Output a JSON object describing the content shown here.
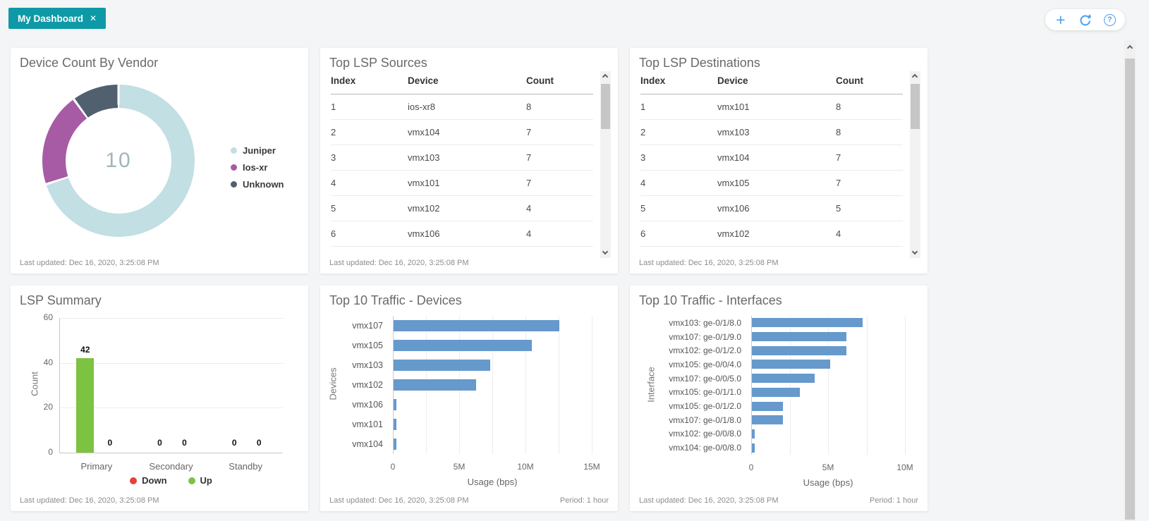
{
  "tab": {
    "label": "My Dashboard",
    "close_icon": "✕"
  },
  "toolbar": {
    "add_icon": "+",
    "help_icon": "?"
  },
  "colors": {
    "tab_teal": "#0e99a6",
    "toolbar_blue": "#49a0ef",
    "bar_blue": "#6699cc",
    "up_green": "#7cc342",
    "down_red": "#e8413c"
  },
  "panels": {
    "vendor": {
      "title": "Device Count By Vendor",
      "last_updated": "Last updated: Dec 16, 2020, 3:25:08 PM",
      "chart_data": {
        "type": "pie",
        "total_label": "10",
        "slices": [
          {
            "label": "Juniper",
            "value": 7,
            "color": "#c2dfe3"
          },
          {
            "label": "Ios-xr",
            "value": 2,
            "color": "#a75ba5"
          },
          {
            "label": "Unknown",
            "value": 1,
            "color": "#51606e"
          }
        ],
        "legend_position": "right"
      }
    },
    "lsp_sources": {
      "title": "Top LSP Sources",
      "columns": [
        "Index",
        "Device",
        "Count"
      ],
      "rows": [
        [
          "1",
          "ios-xr8",
          "8"
        ],
        [
          "2",
          "vmx104",
          "7"
        ],
        [
          "3",
          "vmx103",
          "7"
        ],
        [
          "4",
          "vmx101",
          "7"
        ],
        [
          "5",
          "vmx102",
          "4"
        ],
        [
          "6",
          "vmx106",
          "4"
        ]
      ],
      "last_updated": "Last updated: Dec 16, 2020, 3:25:08 PM"
    },
    "lsp_destinations": {
      "title": "Top LSP Destinations",
      "columns": [
        "Index",
        "Device",
        "Count"
      ],
      "rows": [
        [
          "1",
          "vmx101",
          "8"
        ],
        [
          "2",
          "vmx103",
          "8"
        ],
        [
          "3",
          "vmx104",
          "7"
        ],
        [
          "4",
          "vmx105",
          "7"
        ],
        [
          "5",
          "vmx106",
          "5"
        ],
        [
          "6",
          "vmx102",
          "4"
        ]
      ],
      "last_updated": "Last updated: Dec 16, 2020, 3:25:08 PM"
    },
    "lsp_summary": {
      "title": "LSP Summary",
      "last_updated": "Last updated: Dec 16, 2020, 3:25:08 PM",
      "chart_data": {
        "type": "bar",
        "categories": [
          "Primary",
          "Secondary",
          "Standby"
        ],
        "series": [
          {
            "name": "Down",
            "color": "#e8413c",
            "values": [
              0,
              0,
              0
            ]
          },
          {
            "name": "Up",
            "color": "#7cc342",
            "values": [
              42,
              0,
              0
            ]
          }
        ],
        "slot_order": [
          "Up",
          "Down"
        ],
        "legend": [
          "Down",
          "Up"
        ],
        "ylabel": "Count",
        "yticks": [
          0,
          20,
          40,
          60
        ],
        "ylim": [
          0,
          60
        ],
        "grid": true,
        "legend_position": "bottom"
      }
    },
    "traffic_devices": {
      "title": "Top 10 Traffic - Devices",
      "last_updated": "Last updated: Dec 16, 2020, 3:25:08 PM",
      "period": "Period: 1 hour",
      "chart_data": {
        "type": "bar-horizontal",
        "categories": [
          "vmx107",
          "vmx105",
          "vmx103",
          "vmx102",
          "vmx106",
          "vmx101",
          "vmx104"
        ],
        "values": [
          12500000,
          10400000,
          7300000,
          6200000,
          200000,
          200000,
          200000
        ],
        "bar_color": "#6699cc",
        "xticks": [
          {
            "label": "0",
            "value": 0
          },
          {
            "label": "5M",
            "value": 5000000
          },
          {
            "label": "10M",
            "value": 10000000
          },
          {
            "label": "15M",
            "value": 15000000
          }
        ],
        "xlim": [
          0,
          15000000
        ],
        "grid_step": 2500000,
        "xlabel": "Usage (bps)",
        "ylabel": "Devices"
      }
    },
    "traffic_interfaces": {
      "title": "Top 10 Traffic - Interfaces",
      "last_updated": "Last updated: Dec 16, 2020, 3:25:08 PM",
      "period": "Period: 1 hour",
      "chart_data": {
        "type": "bar-horizontal",
        "categories": [
          "vmx103: ge-0/1/8.0",
          "vmx107: ge-0/1/9.0",
          "vmx102: ge-0/1/2.0",
          "vmx105: ge-0/0/4.0",
          "vmx107: ge-0/0/5.0",
          "vmx105: ge-0/1/1.0",
          "vmx105: ge-0/1/2.0",
          "vmx107: ge-0/1/8.0",
          "vmx102: ge-0/0/8.0",
          "vmx104: ge-0/0/8.0"
        ],
        "values": [
          7200000,
          6150000,
          6150000,
          5100000,
          4100000,
          3100000,
          2000000,
          2000000,
          200000,
          200000
        ],
        "bar_color": "#6699cc",
        "xticks": [
          {
            "label": "0",
            "value": 0
          },
          {
            "label": "5M",
            "value": 5000000
          },
          {
            "label": "10M",
            "value": 10000000
          }
        ],
        "xlim": [
          0,
          10000000
        ],
        "grid_step": 2500000,
        "xlabel": "Usage (bps)",
        "ylabel": "Interface"
      }
    }
  }
}
